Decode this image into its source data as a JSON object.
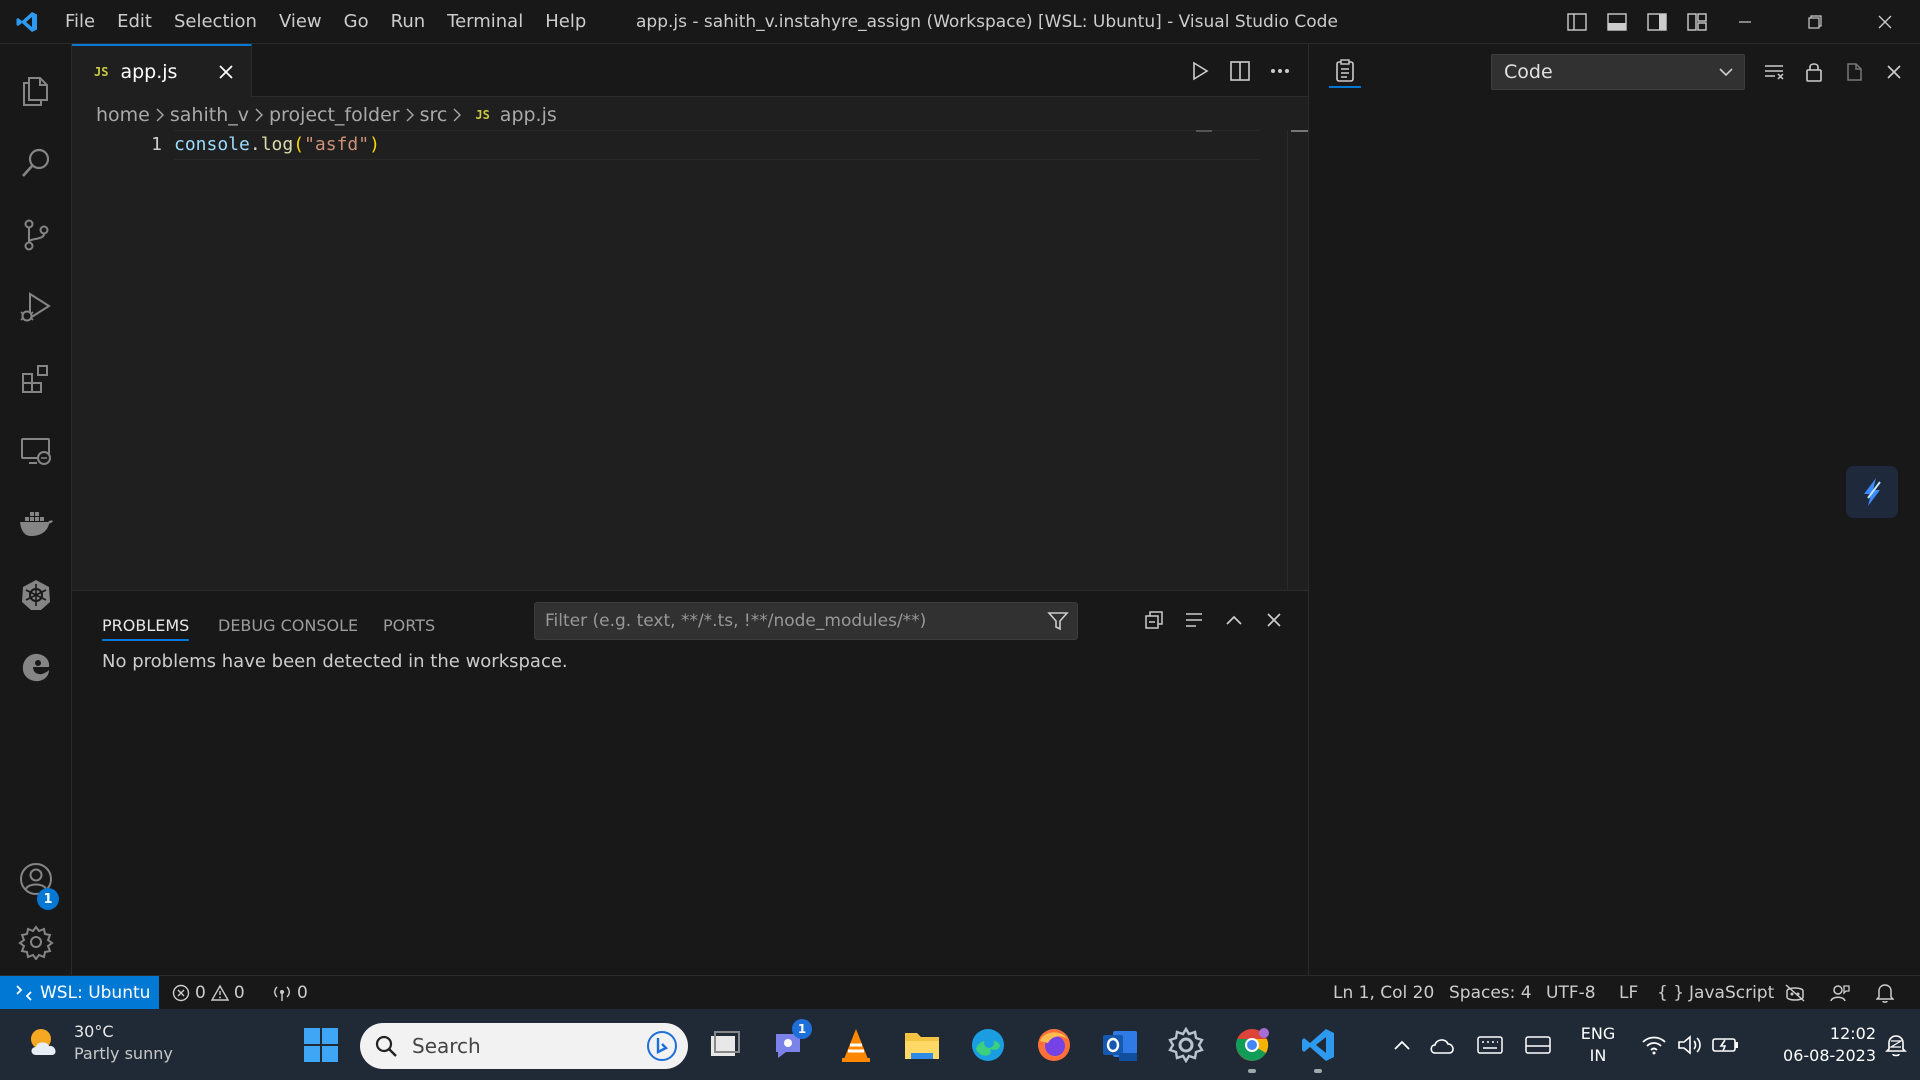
{
  "titlebar": {
    "menu": [
      "File",
      "Edit",
      "Selection",
      "View",
      "Go",
      "Run",
      "Terminal",
      "Help"
    ],
    "window_title": "app.js - sahith_v.instahyre_assign (Workspace) [WSL: Ubuntu] - Visual Studio Code"
  },
  "activity_bar": {
    "items": [
      "explorer-icon",
      "search-icon",
      "source-control-icon",
      "run-debug-icon",
      "extensions-icon",
      "remote-explorer-icon",
      "docker-icon",
      "kubernetes-icon",
      "edge-devtools-icon"
    ],
    "accounts_badge": "1"
  },
  "editor": {
    "tab_badge": "JS",
    "tab_label": "app.js",
    "breadcrumb": [
      "home",
      "sahith_v",
      "project_folder",
      "src"
    ],
    "breadcrumb_file": "app.js",
    "line_number": "1",
    "code": {
      "object": "console",
      "dot": ".",
      "method": "log",
      "open_paren": "(",
      "string": "\"asfd\"",
      "close_paren": ")"
    }
  },
  "panel": {
    "tabs": [
      "PROBLEMS",
      "DEBUG CONSOLE",
      "PORTS"
    ],
    "active_tab": "PROBLEMS",
    "filter_placeholder": "Filter (e.g. text, **/*.ts, !**/node_modules/**)",
    "message": "No problems have been detected in the workspace."
  },
  "right_pane": {
    "select_value": "Code"
  },
  "statusbar": {
    "remote": "WSL: Ubuntu",
    "errors": "0",
    "warnings": "0",
    "ports": "0",
    "position": "Ln 1, Col 20",
    "spaces": "Spaces: 4",
    "encoding": "UTF-8",
    "eol": "LF",
    "language_braces": "{ }",
    "language": "JavaScript"
  },
  "taskbar": {
    "weather_temp": "30°C",
    "weather_desc": "Partly sunny",
    "search_label": "Search",
    "chat_badge": "1",
    "lang_top": "ENG",
    "lang_bottom": "IN",
    "time": "12:02",
    "date": "06-08-2023"
  },
  "colors": {
    "accent": "#0078d4",
    "editor_bg": "#1f1f1f",
    "chrome_bg": "#181818",
    "taskbar_bg": "#202a37"
  }
}
